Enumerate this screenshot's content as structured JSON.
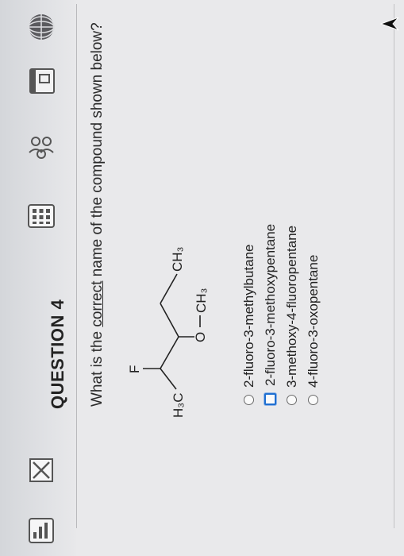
{
  "question": {
    "title": "QUESTION 4",
    "prompt_before": "What is the ",
    "prompt_emphasis": "correct",
    "prompt_after": " name of the compound shown below?"
  },
  "molecule": {
    "labels": {
      "left_methyl": "H₃C",
      "fluorine": "F",
      "oxygen": "O",
      "methoxy_methyl": "CH₃",
      "right_methyl": "CH₃"
    }
  },
  "answers": [
    {
      "label": "2-fluoro-3-methylbutane",
      "focused": false
    },
    {
      "label": "2-fluoro-3-methoxypentane",
      "focused": true
    },
    {
      "label": "3-methoxy-4-fluoropentane",
      "focused": false
    },
    {
      "label": "4-fluoro-3-oxopentane",
      "focused": false
    }
  ],
  "colors": {
    "focus": "#1f6fd1",
    "background": "#e9e9eb",
    "toolbar": "#d4d6da"
  },
  "toolbar_icons": [
    "globe-icon",
    "window-icon",
    "people-icon",
    "keypad-icon",
    "checkbox-x-icon",
    "chart-icon"
  ]
}
